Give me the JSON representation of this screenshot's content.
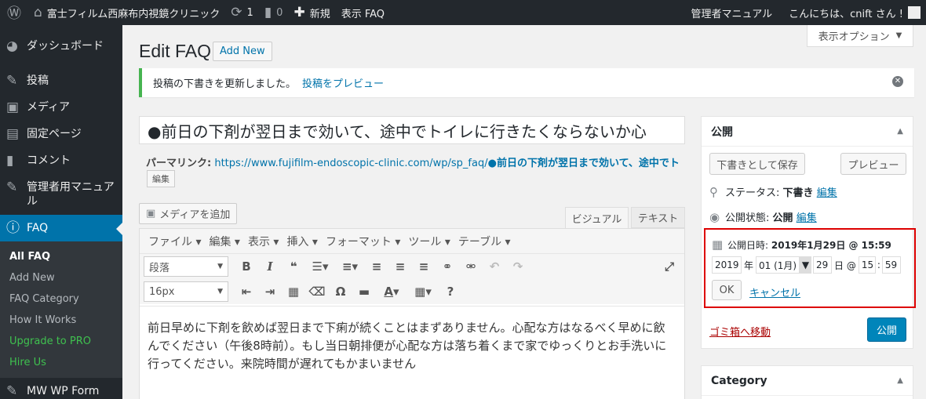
{
  "adminbar": {
    "site_name": "富士フィルム西麻布内視鏡クリニック",
    "updates_count": "1",
    "comments_count": "0",
    "new_label": "新規",
    "view_label": "表示 FAQ",
    "manual_label": "管理者マニュアル",
    "greeting": "こんにちは、cnift さん !"
  },
  "sidebar": {
    "items": [
      {
        "label": "ダッシュボード",
        "icon": "dashboard-icon"
      },
      {
        "label": "投稿",
        "icon": "pin-icon"
      },
      {
        "label": "メディア",
        "icon": "media-icon"
      },
      {
        "label": "固定ページ",
        "icon": "page-icon"
      },
      {
        "label": "コメント",
        "icon": "comment-icon"
      },
      {
        "label": "管理者用マニュアル",
        "icon": "pin-icon"
      },
      {
        "label": "FAQ",
        "icon": "info-icon"
      }
    ],
    "submenu": [
      "All FAQ",
      "Add New",
      "FAQ Category",
      "How It Works",
      "Upgrade to PRO",
      "Hire Us"
    ],
    "last_item": "MW WP Form"
  },
  "screen_options": "表示オプション",
  "header": {
    "title": "Edit FAQ",
    "add_new": "Add New"
  },
  "notice": {
    "text": "投稿の下書きを更新しました。",
    "link": "投稿をプレビュー"
  },
  "post": {
    "title": "●前日の下剤が翌日まで効いて、途中でトイレに行きたくならないか心",
    "permalink_label": "パーマリンク:",
    "permalink_url": "https://www.fujifilm-endoscopic-clinic.com/wp/sp_faq/",
    "permalink_slug": "●前日の下剤が翌日まで効いて、途中でトイレに",
    "edit_slug": "編集"
  },
  "editor": {
    "add_media": "メディアを追加",
    "tab_visual": "ビジュアル",
    "tab_text": "テキスト",
    "menus": [
      "ファイル",
      "編集",
      "表示",
      "挿入",
      "フォーマット",
      "ツール",
      "テーブル"
    ],
    "format_select": "段落",
    "fontsize_select": "16px",
    "content": "前日早めに下剤を飲めば翌日まで下痢が続くことはまずありません。心配な方はなるべく早めに飲んでください（午後8時前）。もし当日朝排便が心配な方は落ち着くまで家でゆっくりとお手洗いに行ってください。来院時間が遅れてもかまいません"
  },
  "publish": {
    "title": "公開",
    "save_draft": "下書きとして保存",
    "preview": "プレビュー",
    "status_label": "ステータス:",
    "status_value": "下書き",
    "visibility_label": "公開状態:",
    "visibility_value": "公開",
    "edit": "編集",
    "date_label": "公開日時:",
    "date_value": "2019年1月29日 @ 15:59",
    "year": "2019",
    "year_suffix": "年",
    "month": "01 (1月)",
    "day": "29",
    "day_suffix": "日 @",
    "hour": "15",
    "minute": "59",
    "ok": "OK",
    "cancel": "キャンセル",
    "trash": "ゴミ箱へ移動",
    "publish": "公開"
  },
  "category_box": {
    "title": "Category"
  },
  "colors": {
    "adminbar": "#23282d",
    "accent": "#0073aa",
    "highlight": "#dd0000",
    "notice": "#46b450"
  }
}
